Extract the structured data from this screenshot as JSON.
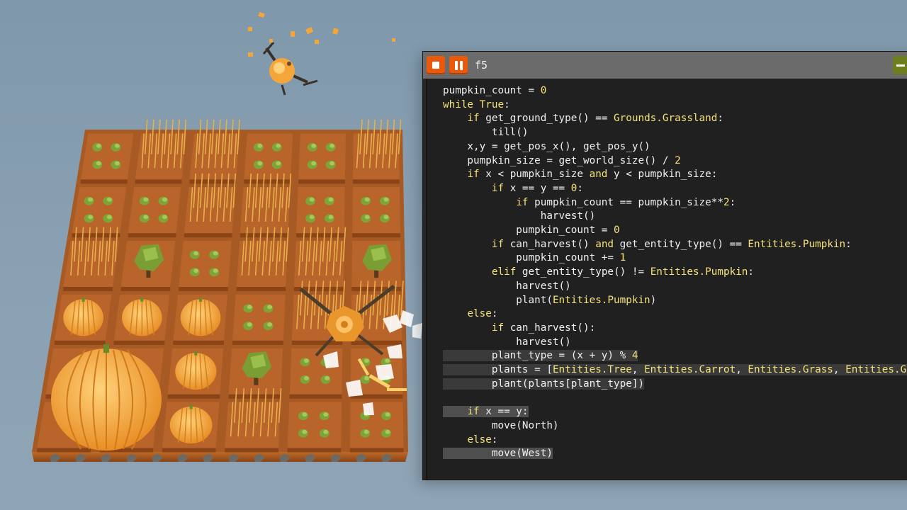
{
  "editor": {
    "window_title": "f5",
    "stop_button": "stop-icon",
    "pause_button": "pause-icon",
    "minimize_button": "minus-icon",
    "colors": {
      "accent": "#e8590c",
      "keyword": "#f5e27a",
      "titlebar": "#6b6b6b",
      "background": "#202020"
    },
    "code_lines": [
      "pumpkin_count = 0",
      "while True:",
      "    if get_ground_type() == Grounds.Grassland:",
      "        till()",
      "    x,y = get_pos_x(), get_pos_y()",
      "    pumpkin_size = get_world_size() / 2",
      "    if x < pumpkin_size and y < pumpkin_size:",
      "        if x == y == 0:",
      "            if pumpkin_count == pumpkin_size**2:",
      "                harvest()",
      "            pumpkin_count = 0",
      "        if can_harvest() and get_entity_type() == Entities.Pumpkin:",
      "            pumpkin_count += 1",
      "        elif get_entity_type() != Entities.Pumpkin:",
      "            harvest()",
      "            plant(Entities.Pumpkin)",
      "    else:",
      "        if can_harvest():",
      "            harvest()",
      "        plant_type = (x + y) % 4",
      "        plants = [Entities.Tree, Entities.Carrot, Entities.Grass, Entities.Gra",
      "        plant(plants[plant_type])",
      "",
      "    if x == y:",
      "        move(North)",
      "    else:",
      "        move(West)"
    ]
  },
  "game": {
    "grid_size": 6,
    "tiles": [
      [
        "carrot",
        "wheat",
        "wheat",
        "carrot",
        "carrot",
        "wheat"
      ],
      [
        "carrot",
        "carrot",
        "wheat",
        "wheat",
        "carrot",
        "carrot"
      ],
      [
        "wheat",
        "tree",
        "carrot",
        "wheat",
        "wheat",
        "tree"
      ],
      [
        "pumpkin",
        "pumpkin",
        "pumpkin",
        "carrot",
        "wheat",
        "wheat"
      ],
      [
        "pumpkin",
        "pumpkin",
        "pumpkin",
        "tree",
        "carrot",
        "carrot"
      ],
      [
        "pumpkin",
        "pumpkin",
        "pumpkin",
        "wheat",
        "carrot",
        "carrot"
      ]
    ],
    "merged_pumpkin": "giant-pumpkin-icon",
    "drone": "drone-icon",
    "colors": {
      "soil": "#b8642a",
      "soil_dark": "#8a4415",
      "crop": "#f0a63a",
      "leaf": "#6f9a2e"
    }
  }
}
